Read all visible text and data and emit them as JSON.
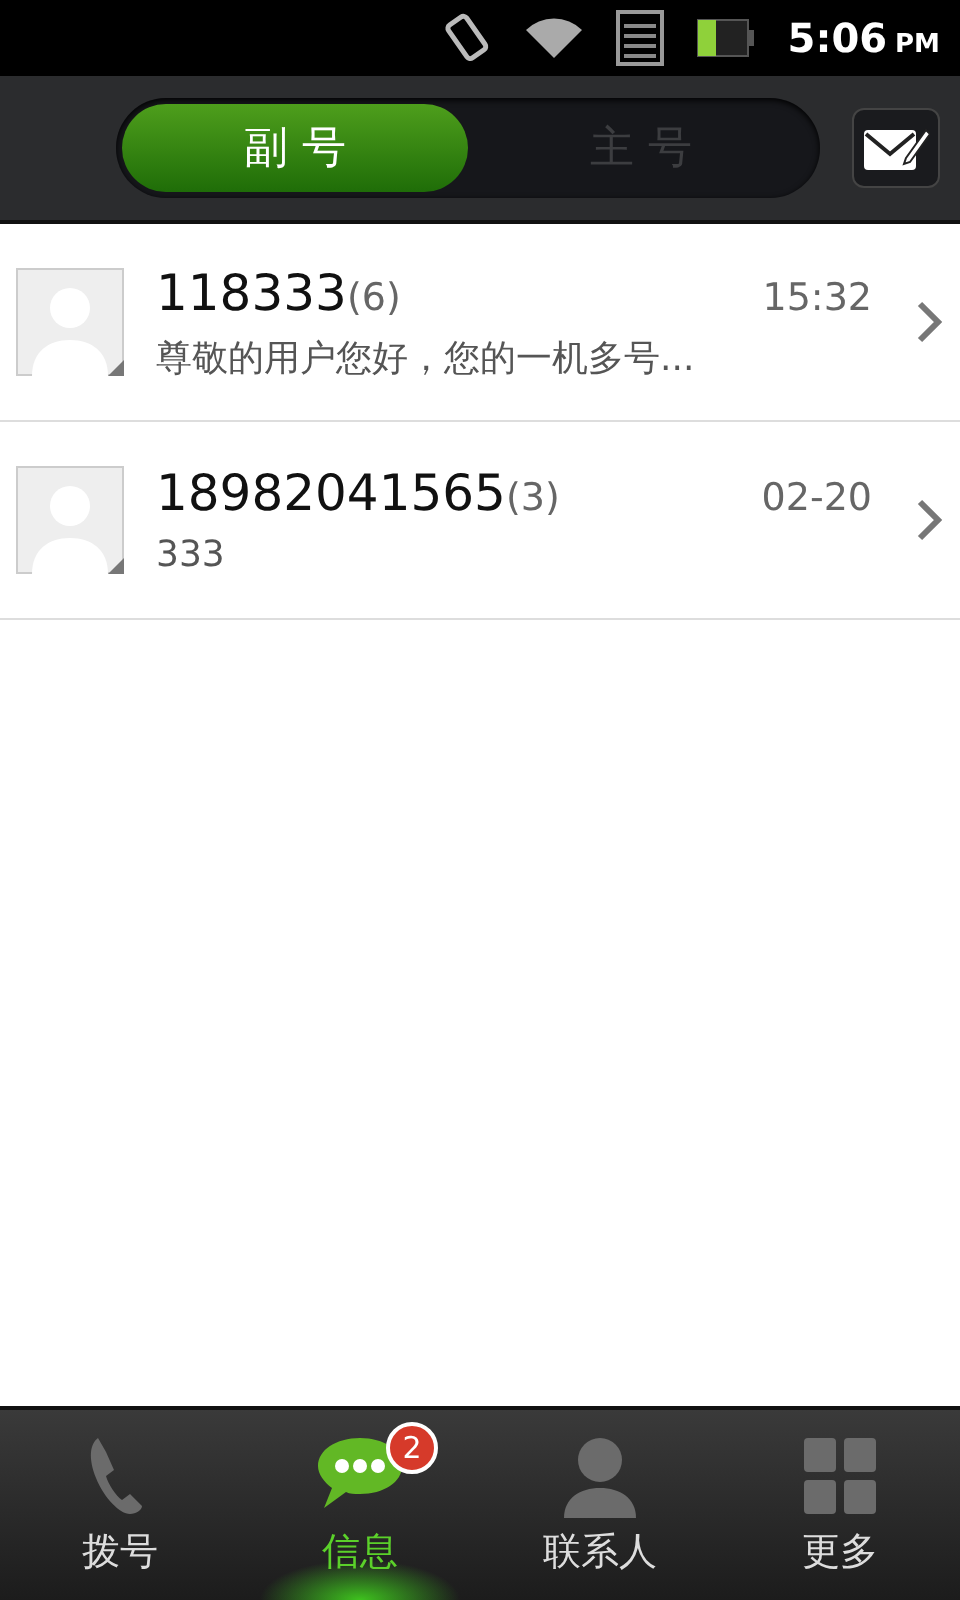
{
  "status_bar": {
    "time": "5:06",
    "ampm": "PM"
  },
  "segments": [
    {
      "label": "副 号",
      "selected": true
    },
    {
      "label": "主 号",
      "selected": false
    }
  ],
  "conversations": [
    {
      "name": "118333",
      "count": "(6)",
      "time": "15:32",
      "preview": "尊敬的用户您好，您的一机多号..."
    },
    {
      "name": "18982041565",
      "count": "(3)",
      "time": "02-20",
      "preview": "333"
    }
  ],
  "bottom_nav": [
    {
      "kind": "phone",
      "label": "拨号",
      "selected": false
    },
    {
      "kind": "message",
      "label": "信息",
      "selected": true,
      "badge": "2"
    },
    {
      "kind": "contact",
      "label": "联系人",
      "selected": false
    },
    {
      "kind": "grid",
      "label": "更多",
      "selected": false
    }
  ]
}
